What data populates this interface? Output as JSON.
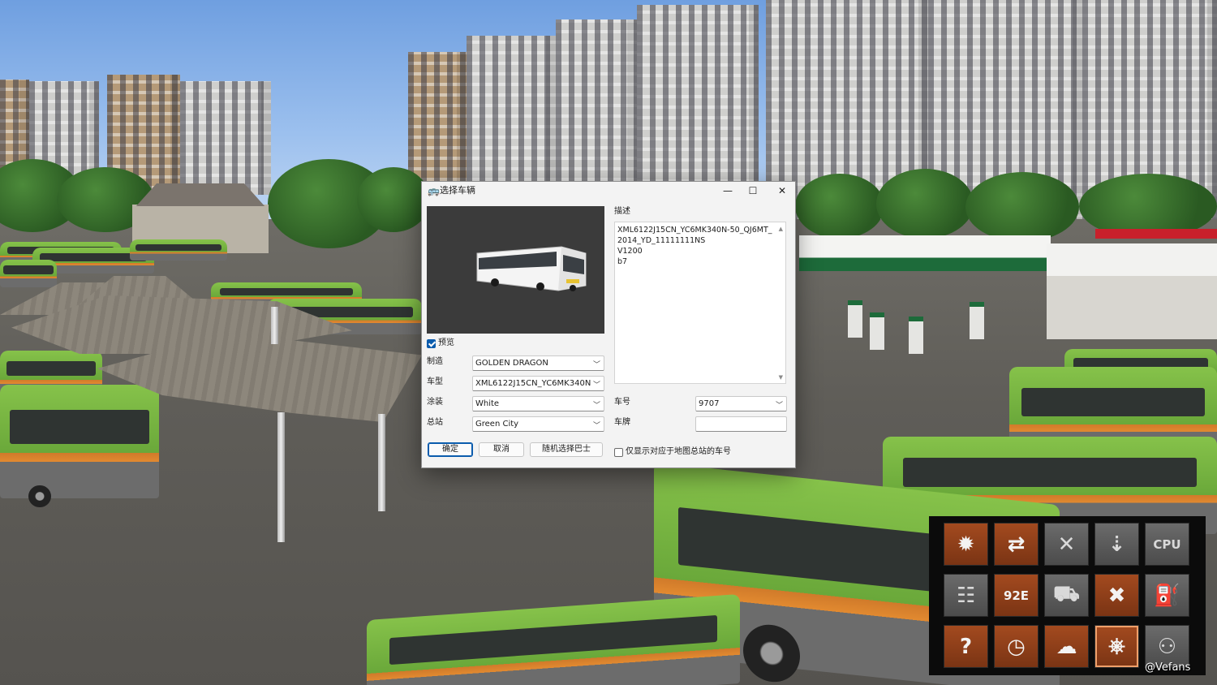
{
  "dialog": {
    "title": "选择车辆",
    "controls": {
      "minimize": "—",
      "maximize": "☐",
      "close": "✕"
    },
    "preview_checkbox": {
      "label": "预览",
      "checked": true
    },
    "fields": {
      "manufacturer": {
        "label": "制造",
        "value": "GOLDEN DRAGON"
      },
      "model": {
        "label": "车型",
        "value": "XML6122J15CN_YC6MK340N-50_QJ6MT_2014_YD_11111111NS"
      },
      "livery": {
        "label": "涂装",
        "value": "White"
      },
      "depot": {
        "label": "总站",
        "value": "Green City"
      },
      "bus_number": {
        "label": "车号",
        "value": "9707"
      },
      "plate": {
        "label": "车牌",
        "value": ""
      }
    },
    "description": {
      "label": "描述",
      "text": "XML6122J15CN_YC6MK340N-50_QJ6MT_2014_YD_11111111NS\nV1200\nb7"
    },
    "buttons": {
      "ok": "确定",
      "cancel": "取消",
      "random": "随机选择巴士"
    },
    "filter_checkbox": {
      "label": "仅显示对应于地图总站的车号",
      "checked": false
    }
  },
  "palette": {
    "tools": [
      {
        "name": "bus-lights-icon",
        "glyph": "✹",
        "style": "orange"
      },
      {
        "name": "bus-transfer-icon",
        "glyph": "⇄",
        "style": "orange"
      },
      {
        "name": "bus-disabled-icon",
        "glyph": "✕",
        "style": "grey"
      },
      {
        "name": "bus-lower-icon",
        "glyph": "⇣",
        "style": "grey"
      },
      {
        "name": "bus-cpu-icon",
        "glyph": "CPU",
        "style": "grey"
      },
      {
        "name": "timetable-icon",
        "glyph": "☷",
        "style": "grey"
      },
      {
        "name": "route-display-icon",
        "glyph": "92E",
        "style": "orange"
      },
      {
        "name": "car-traffic-icon",
        "glyph": "⛟",
        "style": "grey"
      },
      {
        "name": "tools-icon",
        "glyph": "✖",
        "style": "orange"
      },
      {
        "name": "fuel-icon",
        "glyph": "⛽",
        "style": "grey"
      },
      {
        "name": "help-icon",
        "glyph": "?",
        "style": "orange"
      },
      {
        "name": "clock-icon",
        "glyph": "◷",
        "style": "orange"
      },
      {
        "name": "weather-icon",
        "glyph": "☁",
        "style": "orange"
      },
      {
        "name": "steering-wheel-icon",
        "glyph": "⎈",
        "style": "orange"
      },
      {
        "name": "passenger-icon",
        "glyph": "⚇",
        "style": "grey"
      }
    ]
  },
  "watermark": "@Vefans"
}
